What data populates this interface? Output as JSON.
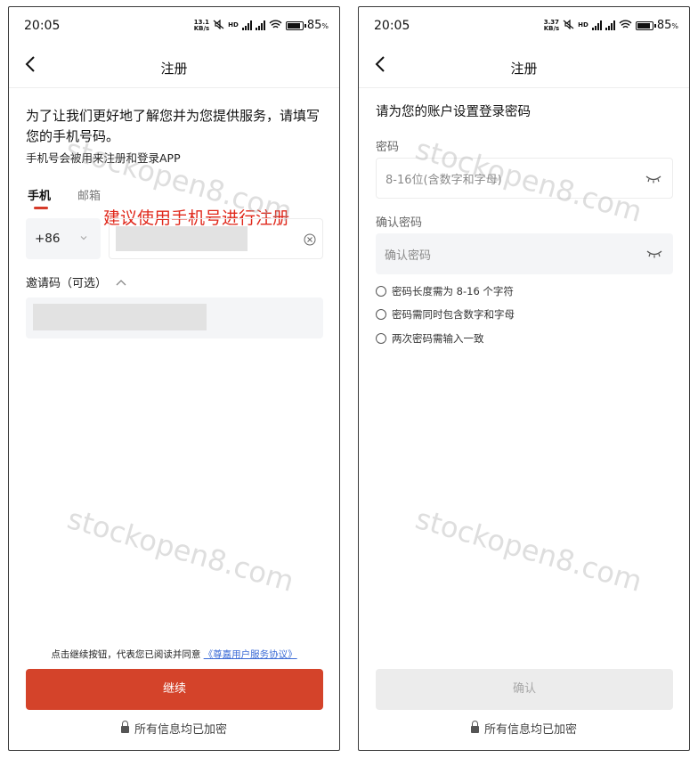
{
  "status_left": {
    "time": "20:05",
    "net_speed_top": "13.1",
    "net_speed_bottom": "KB/s",
    "hd": "HD",
    "battery": "85",
    "battery_unit": "%"
  },
  "status_right": {
    "time": "20:05",
    "net_speed_top": "3.37",
    "net_speed_bottom": "KB/s",
    "hd": "HD",
    "battery": "85",
    "battery_unit": "%"
  },
  "register": {
    "nav_title": "注册",
    "intro": "为了让我们更好地了解您并为您提供服务，请填写您的手机号码。",
    "intro_sub": "手机号会被用来注册和登录APP",
    "tabs": [
      {
        "label": "手机"
      },
      {
        "label": "邮箱"
      }
    ],
    "annotation": "建议使用手机号进行注册",
    "country_code": "+86",
    "invite_label": "邀请码（可选）",
    "agreement_prefix": "点击继续按钮，代表您已阅读并同意",
    "agreement_link": "《尊嘉用户服务协议》",
    "continue_label": "继续",
    "secure_note": "所有信息均已加密"
  },
  "password": {
    "nav_title": "注册",
    "heading": "请为您的账户设置登录密码",
    "password_label": "密码",
    "password_placeholder": "8-16位(含数字和字母)",
    "confirm_label": "确认密码",
    "confirm_placeholder": "确认密码",
    "rules": [
      {
        "text": "密码长度需为 8-16 个字符"
      },
      {
        "text": "密码需同时包含数字和字母"
      },
      {
        "text": "两次密码需输入一致"
      }
    ],
    "confirm_button": "确认",
    "secure_note": "所有信息均已加密"
  },
  "watermark": "stockopen8.com",
  "colors": {
    "accent": "#d4432a",
    "annotation": "#e0281b",
    "link": "#3b6bd6",
    "field_bg": "#f4f5f7"
  }
}
